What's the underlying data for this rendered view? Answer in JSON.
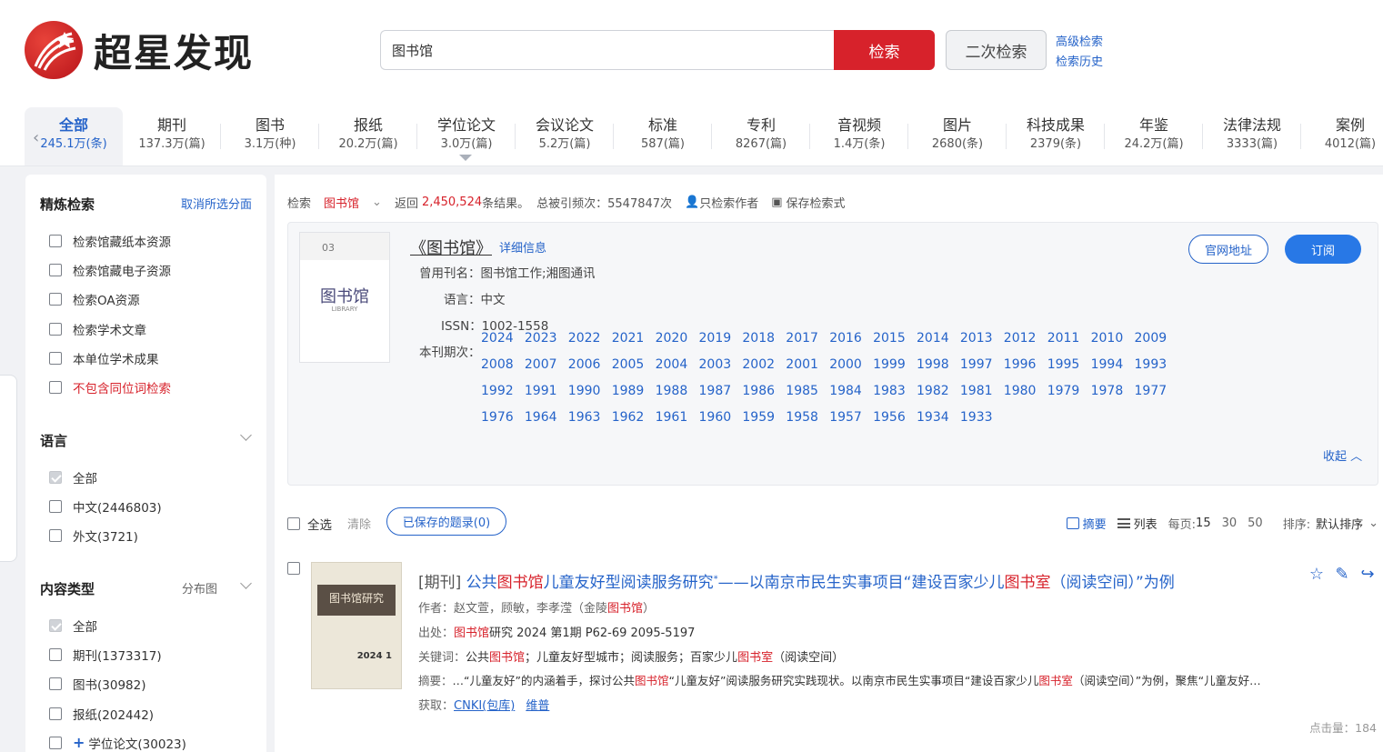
{
  "brand": {
    "name": "超星发现"
  },
  "search": {
    "value": "图书馆",
    "button": "检索",
    "second_button": "二次检索",
    "advanced": "高级检索",
    "history": "检索历史"
  },
  "tabs": [
    {
      "label": "全部",
      "count": "245.1万(条)"
    },
    {
      "label": "期刊",
      "count": "137.3万(篇)"
    },
    {
      "label": "图书",
      "count": "3.1万(种)"
    },
    {
      "label": "报纸",
      "count": "20.2万(篇)"
    },
    {
      "label": "学位论文",
      "count": "3.0万(篇)"
    },
    {
      "label": "会议论文",
      "count": "5.2万(篇)"
    },
    {
      "label": "标准",
      "count": "587(篇)"
    },
    {
      "label": "专利",
      "count": "8267(篇)"
    },
    {
      "label": "音视频",
      "count": "1.4万(条)"
    },
    {
      "label": "图片",
      "count": "2680(条)"
    },
    {
      "label": "科技成果",
      "count": "2379(条)"
    },
    {
      "label": "年鉴",
      "count": "24.2万(篇)"
    },
    {
      "label": "法律法规",
      "count": "3333(篇)"
    },
    {
      "label": "案例",
      "count": "4012(篇)"
    }
  ],
  "sidebar": {
    "refine_title": "精炼检索",
    "clear_label": "取消所选分面",
    "options": [
      "检索馆藏纸本资源",
      "检索馆藏电子资源",
      "检索OA资源",
      "检索学术文章",
      "本单位学术成果",
      "不包含同位词检索"
    ],
    "language_title": "语言",
    "languages": [
      "全部",
      "中文(2446803)",
      "外文(3721)"
    ],
    "content_title": "内容类型",
    "distribution_label": "分布图",
    "content_types": [
      "全部",
      "期刊(1373317)",
      "图书(30982)",
      "报纸(202442)",
      "学位论文(30023)"
    ]
  },
  "info": {
    "prefix": "检索",
    "keyword": "图书馆",
    "returned": "返回",
    "count": "2,450,524",
    "results": "条结果。",
    "cited": "总被引频次：5547847次",
    "author_only": "只检索作者",
    "save_query": "保存检索式"
  },
  "journal": {
    "title": "《图书馆》",
    "detail": "详细信息",
    "former_label": "曾用刊名：",
    "former_value": "图书馆工作;湘图通讯",
    "lang_label": "语言：",
    "lang_value": "中文",
    "issn_label": "ISSN：",
    "issn_value": "1002-1558",
    "issues_label": "本刊期次：",
    "cover_title": "图书馆",
    "cover_sub": "LIBRARY",
    "cover_issue": "03",
    "site_button": "官网地址",
    "subscribe_button": "订阅",
    "collapse": "收起",
    "years": [
      [
        "2024",
        "2023",
        "2022",
        "2021",
        "2020",
        "2019",
        "2018",
        "2017",
        "2016",
        "2015",
        "2014",
        "2013",
        "2012",
        "2011",
        "2010",
        "2009"
      ],
      [
        "2008",
        "2007",
        "2006",
        "2005",
        "2004",
        "2003",
        "2002",
        "2001",
        "2000",
        "1999",
        "1998",
        "1997",
        "1996",
        "1995",
        "1994",
        "1993"
      ],
      [
        "1992",
        "1991",
        "1990",
        "1989",
        "1988",
        "1987",
        "1986",
        "1985",
        "1984",
        "1983",
        "1982",
        "1981",
        "1980",
        "1979",
        "1978",
        "1977"
      ],
      [
        "1976",
        "1964",
        "1963",
        "1962",
        "1961",
        "1960",
        "1959",
        "1958",
        "1957",
        "1956",
        "1934",
        "1933"
      ]
    ]
  },
  "toolbar": {
    "select_all": "全选",
    "clear": "清除",
    "saved": "已保存的题录(0)",
    "summary": "摘要",
    "list": "列表",
    "per_page": "每页:",
    "pp15": "15",
    "pp30": "30",
    "pp50": "50",
    "sort_label": "排序:",
    "sort_value": "默认排序"
  },
  "result": {
    "type": "[期刊]",
    "title_a": "公共",
    "title_hl1": "图书馆",
    "title_b": "儿童友好型阅读服务研究",
    "title_sup": "*",
    "title_c": "——以南京市民生实事项目“建设百家少儿",
    "title_hl2": "图书室",
    "title_d": "（阅读空间）”为例",
    "author_label": "作者：",
    "author_value": "赵文萱，顾敏，李孝滢（金陵",
    "author_hl": "图书馆",
    "author_end": "）",
    "source_label": "出处：",
    "source_hl": "图书馆",
    "source_value": "研究 2024 第1期 P62-69  2095-5197",
    "kw_label": "关键词：",
    "kw_a": "公共",
    "kw_hl1": "图书馆",
    "kw_b": "；儿童友好型城市；阅读服务；百家少儿",
    "kw_hl2": "图书室",
    "kw_c": "（阅读空间）",
    "abs_label": "摘要：",
    "abs_a": "…“儿童友好”的内涵着手，探讨公共",
    "abs_hl1": "图书馆",
    "abs_b": "“儿童友好”阅读服务研究实践现状。以南京市民生实事项目“建设百家少儿",
    "abs_hl2": "图书室",
    "abs_c": "（阅读空间）”为例，聚焦“儿童友好…",
    "get_label": "获取：",
    "link1": "CNKI(包库)",
    "link2": "维普",
    "cover_title": "图书馆研究",
    "cover_num": "2024 1",
    "clicks": "点击量：184"
  }
}
